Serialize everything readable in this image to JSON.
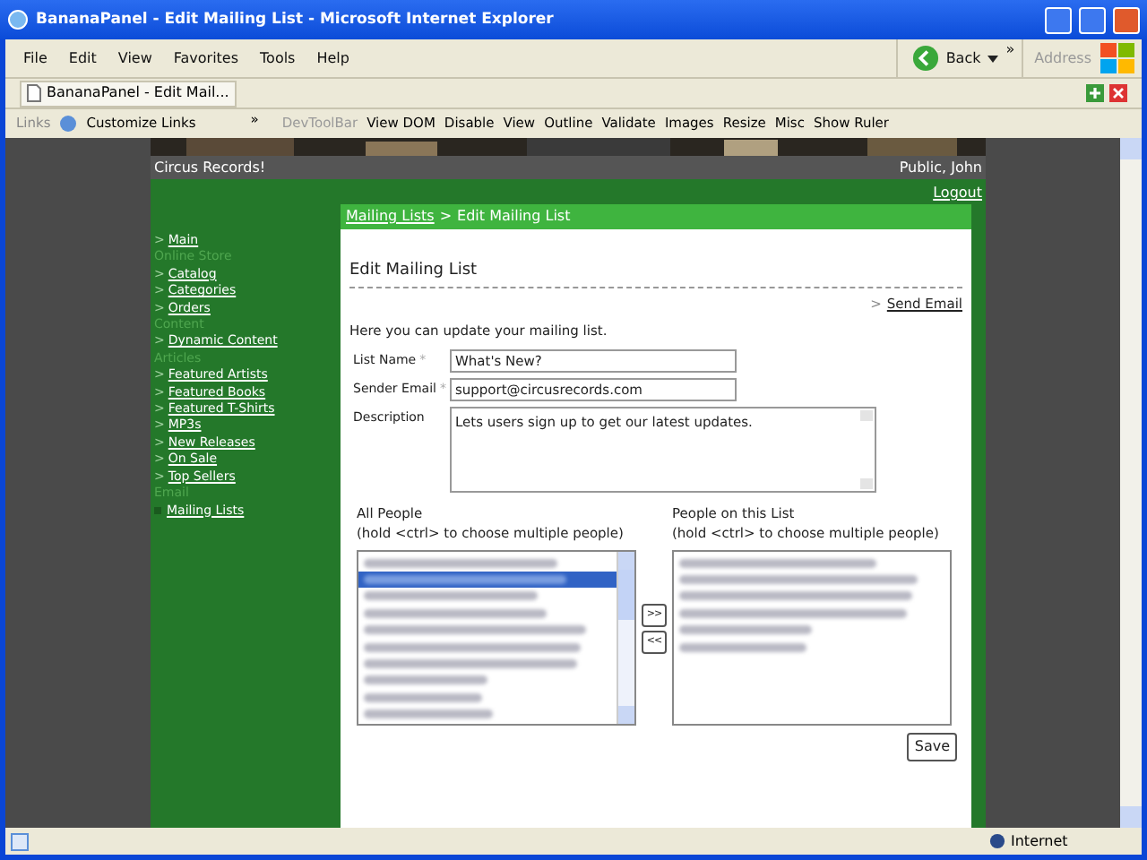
{
  "window": {
    "title": "BananaPanel - Edit Mailing List - Microsoft Internet Explorer"
  },
  "menu": [
    "File",
    "Edit",
    "View",
    "Favorites",
    "Tools",
    "Help"
  ],
  "toolbar": {
    "back": "Back",
    "address": "Address",
    "chevron": "»"
  },
  "tab": {
    "title": "BananaPanel - Edit Mail..."
  },
  "links_bar": {
    "label": "Links",
    "customize": "Customize Links",
    "chevron": "»",
    "devtoolbar": "DevToolBar",
    "items": [
      "View DOM",
      "Disable",
      "View",
      "Outline",
      "Validate",
      "Images",
      "Resize",
      "Misc",
      "Show Ruler"
    ]
  },
  "site": {
    "name": "Circus Records!",
    "user": "Public, John",
    "logout": "Logout"
  },
  "sidebar": [
    {
      "kind": "link",
      "bullet": ">",
      "label": "Main"
    },
    {
      "kind": "heading",
      "label": "Online Store"
    },
    {
      "kind": "link",
      "bullet": ">",
      "label": "Catalog"
    },
    {
      "kind": "link",
      "bullet": ">",
      "label": "Categories"
    },
    {
      "kind": "link",
      "bullet": ">",
      "label": "Orders"
    },
    {
      "kind": "heading",
      "label": "Content"
    },
    {
      "kind": "link",
      "bullet": ">",
      "label": "Dynamic Content"
    },
    {
      "kind": "heading",
      "label": "Articles"
    },
    {
      "kind": "link",
      "bullet": ">",
      "label": "Featured Artists"
    },
    {
      "kind": "link",
      "bullet": ">",
      "label": "Featured Books"
    },
    {
      "kind": "link",
      "bullet": ">",
      "label": "Featured T-Shirts"
    },
    {
      "kind": "link",
      "bullet": ">",
      "label": "MP3s"
    },
    {
      "kind": "link",
      "bullet": ">",
      "label": "New Releases"
    },
    {
      "kind": "link",
      "bullet": ">",
      "label": "On Sale"
    },
    {
      "kind": "link",
      "bullet": ">",
      "label": "Top Sellers"
    },
    {
      "kind": "heading",
      "label": "Email"
    },
    {
      "kind": "current",
      "label": "Mailing Lists"
    }
  ],
  "breadcrumb": {
    "link": "Mailing Lists",
    "sep": ">",
    "current": "Edit Mailing List"
  },
  "heading": "Edit Mailing List",
  "send_email": {
    "bullet": ">",
    "label": "Send Email"
  },
  "intro": "Here you can update your mailing list.",
  "fields": [
    {
      "kind": "input",
      "label": "List Name",
      "required": "*",
      "value": "What's New?"
    },
    {
      "kind": "input",
      "label": "Sender Email",
      "required": "*",
      "value": "support@circusrecords.com"
    },
    {
      "kind": "textarea",
      "label": "Description",
      "value": "Lets users sign up to get our latest updates."
    }
  ],
  "lists": [
    {
      "title": "All People",
      "hint": "(hold <ctrl> to choose multiple people)",
      "scroll": true,
      "entries": [
        {
          "selected": false
        },
        {
          "selected": true
        },
        {
          "selected": false
        },
        {
          "selected": false
        },
        {
          "selected": false
        },
        {
          "selected": false
        },
        {
          "selected": false
        },
        {
          "selected": false
        },
        {
          "selected": false
        },
        {
          "selected": false
        }
      ]
    },
    {
      "title": "People on this List",
      "hint": "(hold <ctrl> to choose multiple people)",
      "scroll": false,
      "entries": [
        {
          "selected": false
        },
        {
          "selected": false
        },
        {
          "selected": false
        },
        {
          "selected": false
        },
        {
          "selected": false
        },
        {
          "selected": false
        }
      ]
    }
  ],
  "move_buttons": [
    ">>",
    "<<"
  ],
  "save": "Save",
  "status_bar": {
    "zone": "Internet"
  }
}
